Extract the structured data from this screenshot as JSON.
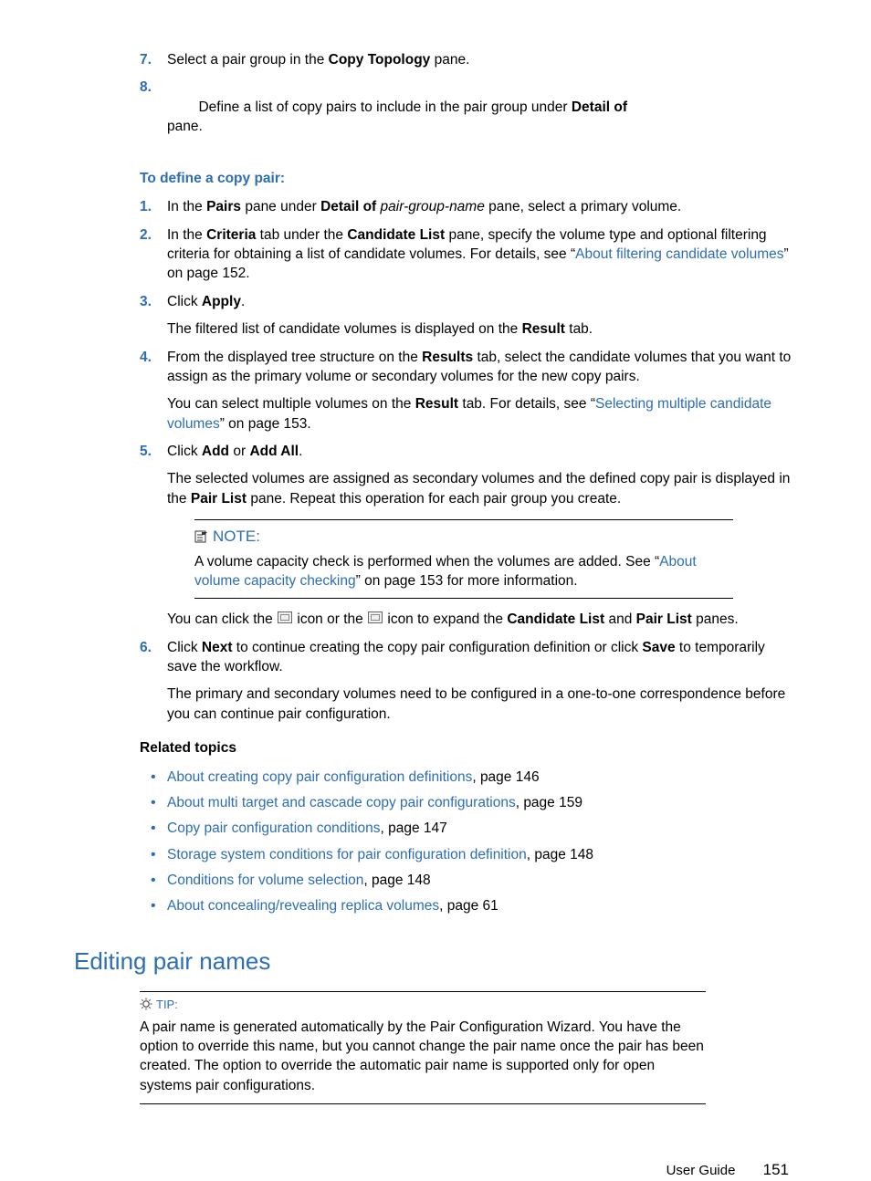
{
  "steps78": [
    {
      "n": "7.",
      "pre": "Select a pair group in the ",
      "b1": "Copy Topology",
      "post": " pane."
    },
    {
      "n": "8.",
      "pre": "Define a list of copy pairs to include in the pair group under ",
      "b1": "Detail of",
      "mid": "                                              ",
      "post": "pane."
    }
  ],
  "subheading": "To define a copy pair:",
  "defsteps": {
    "s1": {
      "n": "1.",
      "t1": "In the ",
      "b1": "Pairs",
      "t2": " pane under ",
      "b2": "Detail of",
      "t3": " ",
      "i1": "pair-group-name",
      "t4": " pane, select a primary volume."
    },
    "s2": {
      "n": "2.",
      "t1": "In the ",
      "b1": "Criteria",
      "t2": " tab under the ",
      "b2": "Candidate List",
      "t3": " pane, specify the volume type and optional filtering criteria for obtaining a list of candidate volumes. For details, see “",
      "l1": "About filtering candidate volumes",
      "t4": "” on page 152."
    },
    "s3": {
      "n": "3.",
      "t1": "Click ",
      "b1": "Apply",
      "t2": ".",
      "p1a": "The filtered list of candidate volumes is displayed on the ",
      "p1b": "Result",
      "p1c": " tab."
    },
    "s4": {
      "n": "4.",
      "t1": "From the displayed tree structure on the ",
      "b1": "Results",
      "t2": " tab, select the candidate volumes that you want to assign as the primary volume or secondary volumes for the new copy pairs.",
      "p1a": "You can select multiple volumes on the ",
      "p1b": "Result",
      "p1c": " tab. For details, see “",
      "l1": "Selecting multiple candidate volumes",
      "p1d": "” on page 153."
    },
    "s5": {
      "n": "5.",
      "t1": "Click ",
      "b1": "Add",
      "t2": " or ",
      "b2": "Add All",
      "t3": ".",
      "p1a": "The selected volumes are assigned as secondary volumes and the defined copy pair is displayed in the ",
      "p1b": "Pair List",
      "p1c": " pane. Repeat this operation for each pair group you create."
    },
    "s6": {
      "n": "6.",
      "t1": "Click ",
      "b1": "Next",
      "t2": " to continue creating the copy pair configuration definition or click ",
      "b2": "Save",
      "t3": " to temporarily save the workflow.",
      "p1": "The primary and secondary volumes need to be configured in a one-to-one correspondence before you can continue pair configuration."
    }
  },
  "note": {
    "title": "NOTE:",
    "body_pre": "A volume capacity check is performed when the volumes are added. See “",
    "body_link": "About volume capacity checking",
    "body_post": "” on page 153 for more information."
  },
  "iconline": {
    "a": "You can click the ",
    "b": " icon or the ",
    "c": " icon to expand the ",
    "d": "Candidate List",
    "e": " and ",
    "f": "Pair List",
    "g": " panes."
  },
  "related_head": "Related topics",
  "related": [
    {
      "link": "About creating copy pair configuration definitions",
      "page": ", page 146"
    },
    {
      "link": "About multi target and cascade copy pair configurations",
      "page": ", page 159"
    },
    {
      "link": "Copy pair configuration conditions",
      "page": ", page 147"
    },
    {
      "link": "Storage system conditions for pair configuration definition",
      "page": ", page 148"
    },
    {
      "link": "Conditions for volume selection",
      "page": ", page 148"
    },
    {
      "link": "About concealing/revealing replica volumes",
      "page": ", page 61"
    }
  ],
  "section_title": "Editing pair names",
  "tip": {
    "title": "TIP:",
    "body": "A pair name is generated automatically by the Pair Configuration Wizard. You have the option to override this name, but you cannot change the pair name once the pair has been created. The option to override the automatic pair name is supported only for open systems pair configurations."
  },
  "footer": {
    "doc": "User Guide",
    "page": "151"
  }
}
